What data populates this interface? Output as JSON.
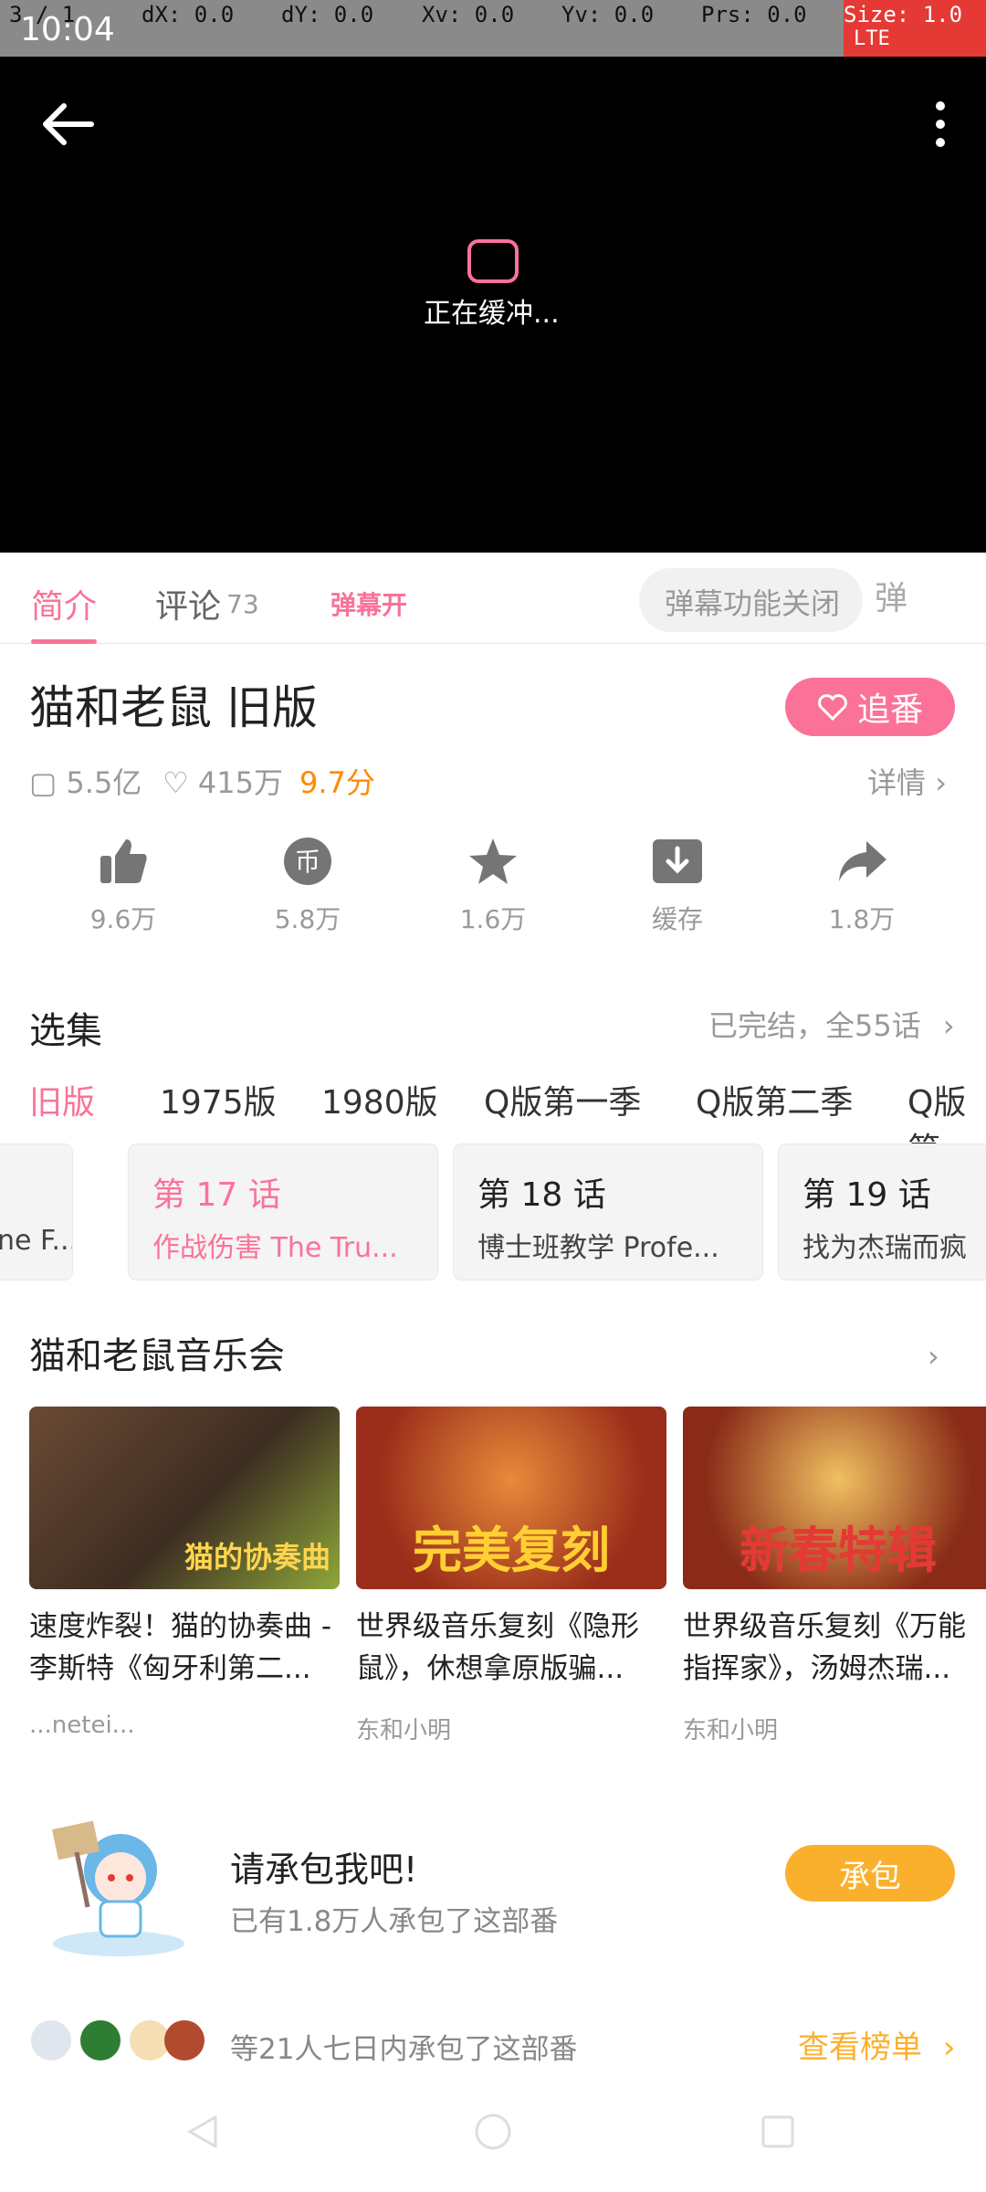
{
  "status_bar": {
    "time": "10:04",
    "overlay_fields": [
      "3 / 1",
      "dX: 0.0",
      "dY: 0.0",
      "Xv: 0.0",
      "Yv: 0.0",
      "Prs: 0.0",
      "Size: 1.0"
    ],
    "network": "LTE"
  },
  "player": {
    "buffering_text": "正在缓冲..."
  },
  "tabs": {
    "intro": "简介",
    "comments": "评论",
    "comments_count": "73",
    "danmaku_icon_label": "弹幕开",
    "danmaku_placeholder": "弹幕功能关闭",
    "danmaku_toggle": "弹"
  },
  "header": {
    "title": "猫和老鼠 旧版",
    "follow_label": "追番"
  },
  "stats": {
    "plays": "5.5亿",
    "followers": "415万",
    "rating": "9.7分",
    "details_link": "详情"
  },
  "actions": [
    {
      "name": "like",
      "value": "9.6万"
    },
    {
      "name": "coin",
      "value": "5.8万"
    },
    {
      "name": "favorite",
      "value": "1.6万"
    },
    {
      "name": "cache",
      "value": "缓存"
    },
    {
      "name": "share",
      "value": "1.8万"
    }
  ],
  "episodes": {
    "section_title": "选集",
    "status": "已完结，全55话",
    "versions": [
      "旧版",
      "1975版",
      "1980版",
      "Q版第一季",
      "Q版第二季",
      "Q版第"
    ],
    "items": [
      {
        "number": "",
        "desc": "ne F..."
      },
      {
        "number": "第 17 话",
        "desc": "作战伤害 The Tru..."
      },
      {
        "number": "第 18 话",
        "desc": "博士班教学 Profe..."
      },
      {
        "number": "第 19 话",
        "desc": "找为杰瑞而疯"
      }
    ]
  },
  "concerts": {
    "section_title": "猫和老鼠音乐会",
    "items": [
      {
        "title": "速度炸裂！猫的协奏曲 - 李斯特《匈牙利第二...",
        "uploader": "...netei...",
        "thumb_caption": "猫的协奏曲"
      },
      {
        "title": "世界级音乐复刻《隐形鼠》，休想拿原版骗...",
        "uploader": "东和小明",
        "thumb_caption": "完美复刻"
      },
      {
        "title": "世界级音乐复刻《万能指挥家》，汤姆杰瑞...",
        "uploader": "东和小明",
        "thumb_caption": "新春特辑"
      }
    ]
  },
  "sponsor": {
    "title": "请承包我吧!",
    "subtitle": "已有1.8万人承包了这部番",
    "button": "承包",
    "rank_text": "等21人七日内承包了这部番",
    "rank_link": "查看榜单"
  },
  "colors": {
    "accent": "#fb7299",
    "sponsor": "#fbb02d",
    "rating": "#ff8a00"
  }
}
